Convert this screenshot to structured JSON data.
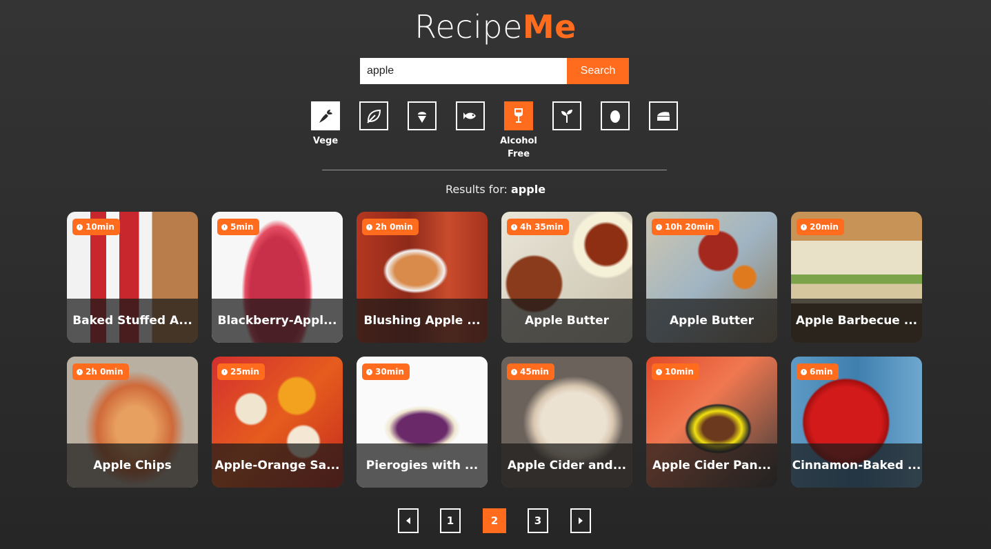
{
  "brand": {
    "part1": "Recipe",
    "part2": "Me",
    "accent_color": "#ff6c1e"
  },
  "search": {
    "value": "apple",
    "button_label": "Search"
  },
  "filters": [
    {
      "icon": "carrot-icon",
      "label": "Vege",
      "state": "active-white"
    },
    {
      "icon": "leaf-icon",
      "label": "",
      "state": "inactive"
    },
    {
      "icon": "ice-cream-icon",
      "label": "",
      "state": "inactive"
    },
    {
      "icon": "fish-icon",
      "label": "",
      "state": "inactive"
    },
    {
      "icon": "wine-glass-icon",
      "label": "Alcohol Free",
      "state": "active-orange"
    },
    {
      "icon": "sprout-icon",
      "label": "",
      "state": "inactive"
    },
    {
      "icon": "egg-icon",
      "label": "",
      "state": "inactive"
    },
    {
      "icon": "cheese-icon",
      "label": "",
      "state": "inactive"
    }
  ],
  "results": {
    "prefix": "Results for:",
    "query": "apple"
  },
  "recipes": [
    {
      "time": "10min",
      "title": "Baked Stuffed A..."
    },
    {
      "time": "5min",
      "title": "Blackberry-Appl..."
    },
    {
      "time": "2h 0min",
      "title": "Blushing Apple ..."
    },
    {
      "time": "4h 35min",
      "title": "Apple Butter"
    },
    {
      "time": "10h 20min",
      "title": "Apple Butter"
    },
    {
      "time": "20min",
      "title": "Apple Barbecue ..."
    },
    {
      "time": "2h 0min",
      "title": "Apple Chips"
    },
    {
      "time": "25min",
      "title": "Apple-Orange Sa..."
    },
    {
      "time": "30min",
      "title": "Pierogies with ..."
    },
    {
      "time": "45min",
      "title": "Apple Cider and..."
    },
    {
      "time": "10min",
      "title": "Apple Cider Pan..."
    },
    {
      "time": "6min",
      "title": "Cinnamon-Baked ..."
    }
  ],
  "pagination": {
    "pages": [
      "1",
      "2",
      "3"
    ],
    "current": "2"
  }
}
